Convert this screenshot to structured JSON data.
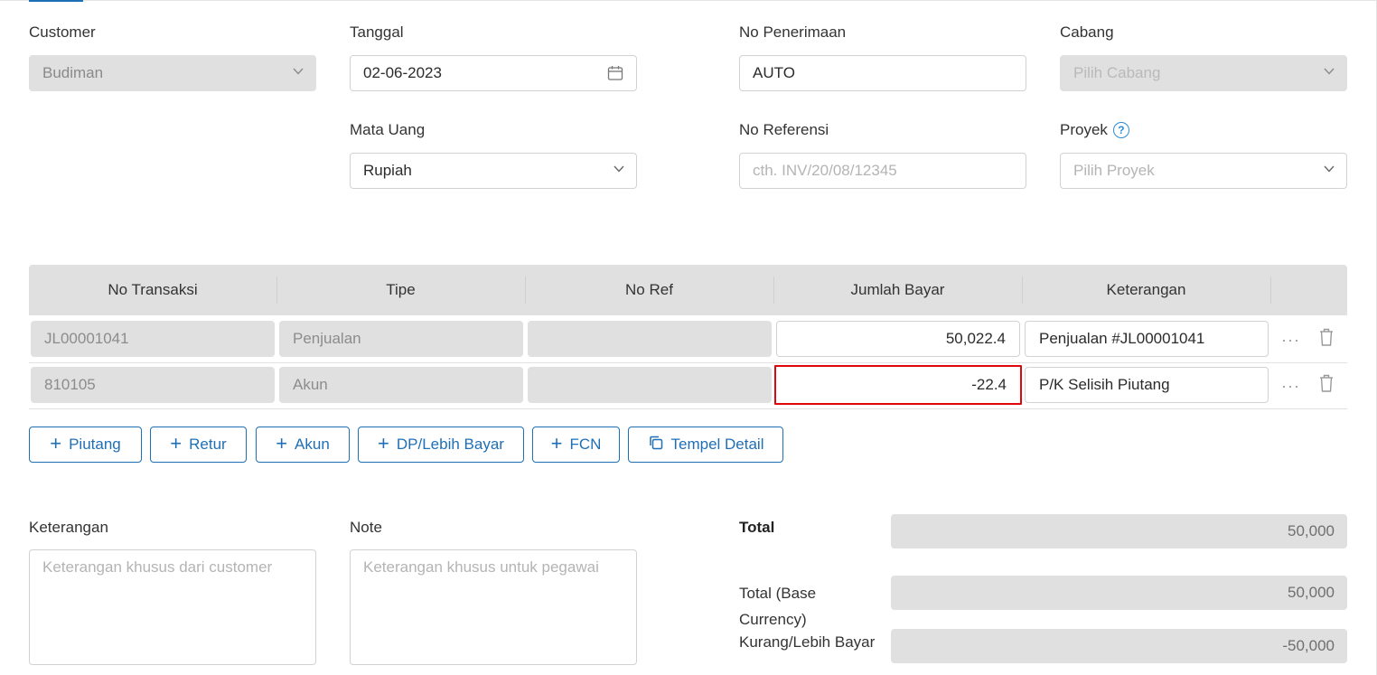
{
  "form": {
    "customer": {
      "label": "Customer",
      "value": "Budiman"
    },
    "tanggal": {
      "label": "Tanggal",
      "value": "02-06-2023"
    },
    "no_penerimaan": {
      "label": "No Penerimaan",
      "value": "AUTO"
    },
    "cabang": {
      "label": "Cabang",
      "placeholder": "Pilih Cabang"
    },
    "mata_uang": {
      "label": "Mata Uang",
      "value": "Rupiah"
    },
    "no_referensi": {
      "label": "No Referensi",
      "placeholder": "cth. INV/20/08/12345"
    },
    "proyek": {
      "label": "Proyek",
      "placeholder": "Pilih Proyek",
      "help_icon": "?"
    }
  },
  "table": {
    "headers": [
      "No Transaksi",
      "Tipe",
      "No Ref",
      "Jumlah Bayar",
      "Keterangan"
    ],
    "rows": [
      {
        "no_transaksi": "JL00001041",
        "tipe": "Penjualan",
        "no_ref": "",
        "jumlah_bayar": "50,022.4",
        "keterangan": "Penjualan #JL00001041",
        "more": "···"
      },
      {
        "no_transaksi": "810105",
        "tipe": "Akun",
        "no_ref": "",
        "jumlah_bayar": "-22.4",
        "keterangan": "P/K Selisih Piutang",
        "more": "···"
      }
    ]
  },
  "buttons": {
    "piutang": "Piutang",
    "retur": "Retur",
    "akun": "Akun",
    "dp": "DP/Lebih Bayar",
    "fcn": "FCN",
    "tempel": "Tempel Detail",
    "plus": "+"
  },
  "notes": {
    "keterangan": {
      "label": "Keterangan",
      "placeholder": "Keterangan khusus dari customer"
    },
    "note": {
      "label": "Note",
      "placeholder": "Keterangan khusus untuk pegawai"
    }
  },
  "totals": {
    "total": {
      "label": "Total",
      "value": "50,000"
    },
    "total_base_line1": "Total (Base",
    "total_base_line2": "Currency)",
    "total_base_value": "50,000",
    "kurang": {
      "label": "Kurang/Lebih Bayar",
      "value": "-50,000"
    }
  },
  "colors": {
    "accent": "#1f6fb6",
    "highlight": "#e0060a",
    "disabled_bg": "#e0e0e0"
  }
}
